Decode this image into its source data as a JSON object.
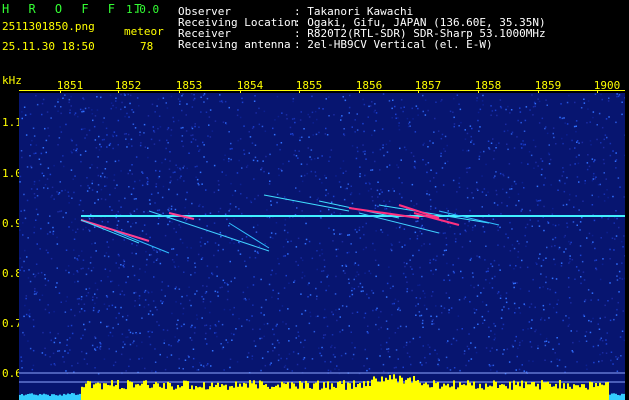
{
  "app": {
    "title": "H R O F F T",
    "version": "1.0.0"
  },
  "file": {
    "filename": "2511301850.png",
    "date_time": "25.11.30 18:50",
    "label": "meteor",
    "count": "78"
  },
  "info": {
    "observer_label": "Observer",
    "observer_value": ": Takanori Kawachi",
    "location_label": "Receiving Location",
    "location_value": ": Ogaki, Gifu, JAPAN (136.60E, 35.35N)",
    "receiver_label": "Receiver",
    "receiver_value": ": R820T2(RTL-SDR) SDR-Sharp 53.1000MHz",
    "antenna_label": "Receiving antenna",
    "antenna_value": ": 2el-HB9CV Vertical (el. E-W)"
  },
  "axes": {
    "y_unit": "kHz",
    "x_ticks": [
      "1851",
      "1852",
      "1853",
      "1854",
      "1855",
      "1856",
      "1857",
      "1858",
      "1859",
      "1900"
    ],
    "y_ticks": [
      "1.1",
      "1.0",
      "0.9",
      "0.8",
      "0.7",
      "0.6"
    ]
  },
  "colors": {
    "background_noise": "#0a1a8a",
    "carrier_line": "#40f0ff",
    "meteor": "#ff3080",
    "bottom_bar": "#ffff00",
    "axis_text": "#ffff00"
  }
}
